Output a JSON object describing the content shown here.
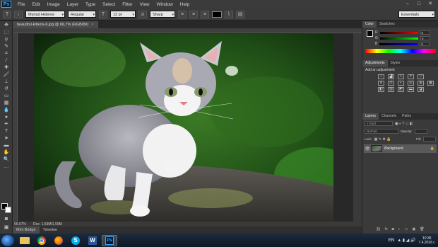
{
  "app": {
    "logo": "Ps"
  },
  "menubar": {
    "items": [
      "File",
      "Edit",
      "Image",
      "Layer",
      "Type",
      "Select",
      "Filter",
      "View",
      "Window",
      "Help"
    ]
  },
  "options": {
    "font_family": "Myriad Hebrew",
    "font_style": "Regular",
    "font_size": "12 pt",
    "antialias": "Sharp",
    "text_color": "#000000",
    "workspace": "Essentials"
  },
  "document": {
    "tab_label": "beautiful-kittens-6.jpg @ 66,7% (RGB/8#)"
  },
  "status": {
    "zoom": "66,67%",
    "doc_size": "Doc: 1,59M/1,59M"
  },
  "bottom_tabs": [
    "Mini Bridge",
    "Timeline"
  ],
  "color_panel": {
    "tabs": [
      "Color",
      "Swatches"
    ],
    "r_label": "R",
    "g_label": "G",
    "b_label": "B",
    "r_value": "0",
    "g_value": "0",
    "b_value": "0"
  },
  "adjustments_panel": {
    "tabs": [
      "Adjustments",
      "Styles"
    ],
    "heading": "Add an adjustment"
  },
  "layers_panel": {
    "tabs": [
      "Layers",
      "Channels",
      "Paths"
    ],
    "kind": "Kind",
    "blend_mode": "Normal",
    "opacity_label": "Opacity:",
    "lock_label": "Lock:",
    "fill_label": "Fill:",
    "layer_name": "Background"
  },
  "taskbar": {
    "lang": "EN",
    "time": "10:36",
    "date": "7.4.2016 г."
  },
  "colors": {
    "ps_blue": "#31a8ff",
    "panel": "#3a3a3a",
    "dark": "#282828"
  }
}
